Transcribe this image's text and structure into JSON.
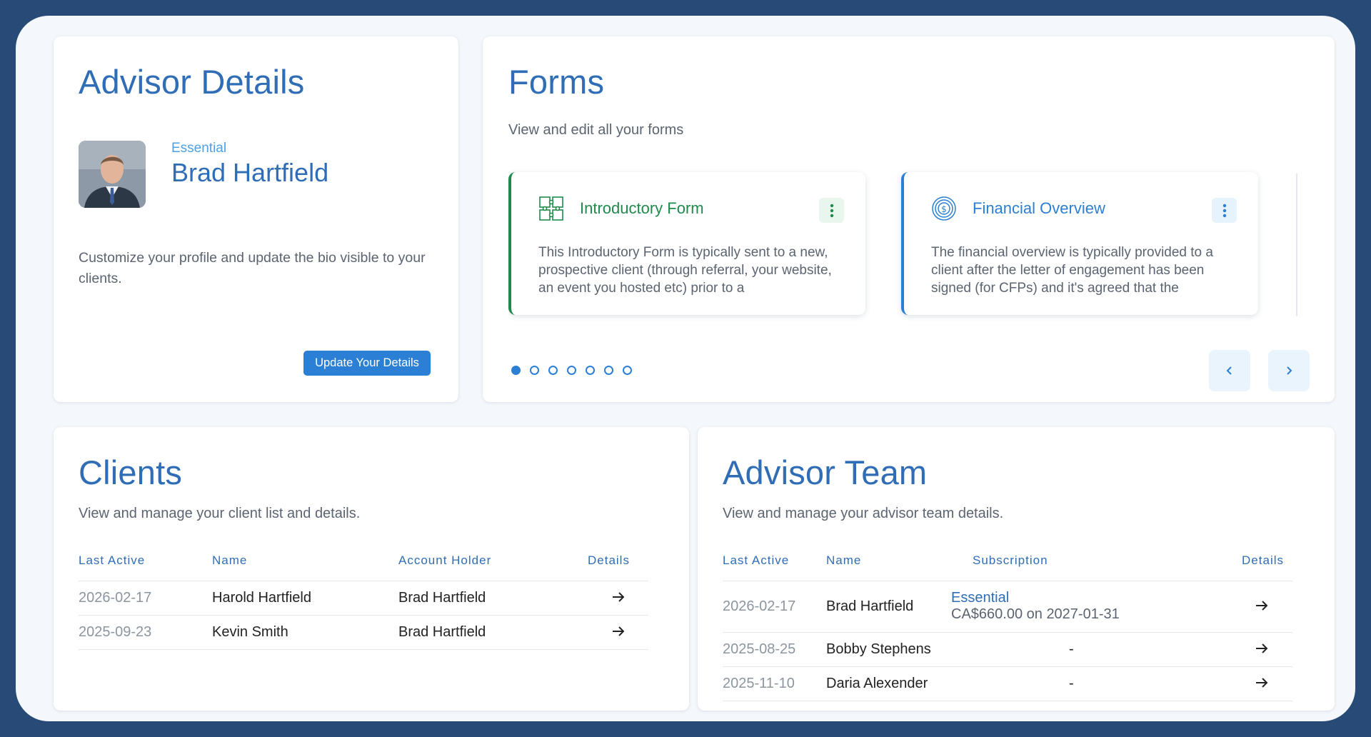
{
  "colors": {
    "frame_bg": "#274a76",
    "accent": "#2f6db6",
    "button": "#2b7fd4",
    "intro_green": "#1f8a4c",
    "financial_blue": "#2b7fd4"
  },
  "advisor_details": {
    "title": "Advisor Details",
    "plan": "Essential",
    "name": "Brad Hartfield",
    "description": "Customize your profile and update the bio visible to your clients.",
    "button_label": "Update Your Details"
  },
  "forms": {
    "title": "Forms",
    "subtitle": "View and edit all your forms",
    "cards": [
      {
        "title": "Introductory Form",
        "icon": "puzzle-icon",
        "description": "This Introductory Form is typically sent to a new, prospective client (through referral, your website, an event you hosted etc) prior to a"
      },
      {
        "title": "Financial Overview",
        "icon": "dollar-coin-icon",
        "description": "The financial overview is typically provided to a client after the letter of engagement has been signed (for CFPs) and it's agreed that the"
      }
    ],
    "total_pages": 7,
    "active_page": 1
  },
  "clients": {
    "title": "Clients",
    "subtitle": "View and manage your client list and details.",
    "columns": [
      "Last Active",
      "Name",
      "Account Holder",
      "Details"
    ],
    "rows": [
      {
        "last_active": "2026-02-17",
        "name": "Harold Hartfield",
        "account_holder": "Brad Hartfield"
      },
      {
        "last_active": "2025-09-23",
        "name": "Kevin Smith",
        "account_holder": "Brad Hartfield"
      }
    ]
  },
  "advisor_team": {
    "title": "Advisor Team",
    "subtitle": "View and manage your advisor team details.",
    "columns": [
      "Last Active",
      "Name",
      "Subscription",
      "Details"
    ],
    "rows": [
      {
        "last_active": "2026-02-17",
        "name": "Brad Hartfield",
        "subscription_plan": "Essential",
        "subscription_price": "CA$660.00 on 2027-01-31"
      },
      {
        "last_active": "2025-08-25",
        "name": "Bobby Stephens",
        "subscription_plan": "-",
        "subscription_price": ""
      },
      {
        "last_active": "2025-11-10",
        "name": "Daria Alexender",
        "subscription_plan": "-",
        "subscription_price": ""
      }
    ]
  }
}
